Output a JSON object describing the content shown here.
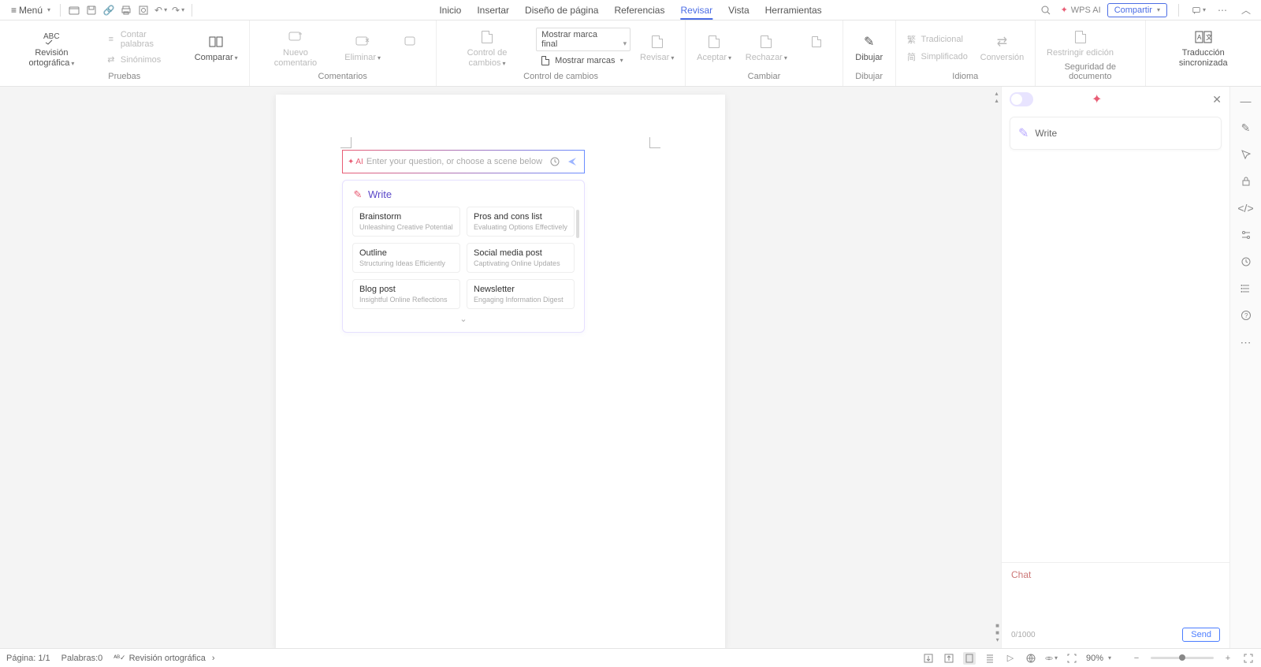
{
  "quickbar": {
    "menu": "Menú"
  },
  "tabs": [
    "Inicio",
    "Insertar",
    "Diseño de página",
    "Referencias",
    "Revisar",
    "Vista",
    "Herramientas"
  ],
  "active_tab_index": 4,
  "topright": {
    "wps_ai": "WPS AI",
    "share": "Compartir"
  },
  "ribbon": {
    "groups": [
      {
        "label": "Pruebas",
        "items": {
          "spell": "Revisión ortográfica",
          "count": "Contar palabras",
          "syn": "Sinónimos",
          "compare": "Comparar"
        }
      },
      {
        "label": "Comentarios",
        "items": {
          "new": "Nuevo comentario",
          "del": "Eliminar"
        }
      },
      {
        "label": "Control de cambios",
        "items": {
          "track": "Control de cambios",
          "final": "Mostrar marca final",
          "marks": "Mostrar marcas",
          "review": "Revisar"
        }
      },
      {
        "label": "Cambiar",
        "items": {
          "accept": "Aceptar",
          "reject": "Rechazar"
        }
      },
      {
        "label": "Dibujar",
        "items": {
          "draw": "Dibujar"
        }
      },
      {
        "label": "Idioma",
        "items": {
          "trad": "Tradicional",
          "simp": "Simplificado",
          "conv": "Conversión"
        }
      },
      {
        "label": "Seguridad de documento",
        "items": {
          "restrict": "Restringir edición"
        }
      },
      {
        "label": "",
        "items": {
          "sync": "Traducción sincronizada"
        }
      }
    ]
  },
  "ai_popup": {
    "badge": "AI",
    "placeholder": "Enter your question, or choose a scene below",
    "section_title": "Write",
    "scenes": [
      {
        "title": "Brainstorm",
        "desc": "Unleashing Creative Potential"
      },
      {
        "title": "Pros and cons list",
        "desc": "Evaluating Options Effectively"
      },
      {
        "title": "Outline",
        "desc": "Structuring Ideas Efficiently"
      },
      {
        "title": "Social media post",
        "desc": "Captivating Online Updates"
      },
      {
        "title": "Blog post",
        "desc": "Insightful Online Reflections"
      },
      {
        "title": "Newsletter",
        "desc": "Engaging Information Digest"
      }
    ]
  },
  "ai_panel": {
    "write_label": "Write",
    "chat_label": "Chat",
    "char_count": "0/1000",
    "send": "Send"
  },
  "status": {
    "page": "Página: 1/1",
    "words": "Palabras:0",
    "spell": "Revisión ortográfica",
    "zoom": "90%"
  }
}
